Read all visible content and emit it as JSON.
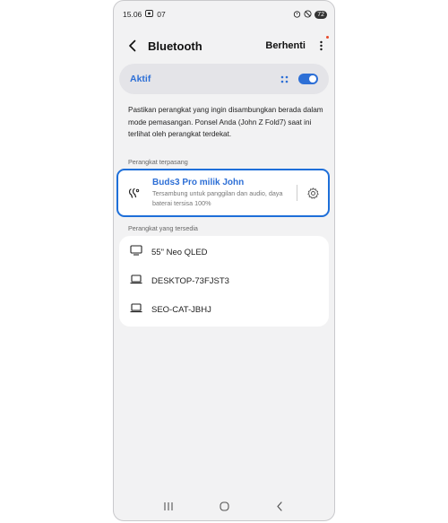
{
  "statusbar": {
    "time": "15.06",
    "extra": "07",
    "battery": "72"
  },
  "header": {
    "title": "Bluetooth",
    "stop_label": "Berhenti"
  },
  "toggle_card": {
    "label": "Aktif",
    "state": "on"
  },
  "description": "Pastikan perangkat yang ingin disambungkan berada dalam mode pemasangan. Ponsel Anda (John Z Fold7) saat ini terlihat oleh perangkat terdekat.",
  "paired": {
    "section_label": "Perangkat terpasang",
    "device": {
      "name": "Buds3 Pro milik John",
      "status": "Tersambung untuk panggilan dan audio, daya baterai tersisa 100%",
      "icon": "earbuds-icon"
    }
  },
  "available": {
    "section_label": "Perangkat yang tersedia",
    "devices": [
      {
        "name": "55\" Neo QLED",
        "icon": "tv-icon"
      },
      {
        "name": "DESKTOP-73FJST3",
        "icon": "laptop-icon"
      },
      {
        "name": "SEO-CAT-JBHJ",
        "icon": "laptop-icon"
      }
    ]
  },
  "colors": {
    "accent": "#2d6fd6",
    "highlight": "#1e6fd9",
    "background": "#f2f2f3"
  }
}
